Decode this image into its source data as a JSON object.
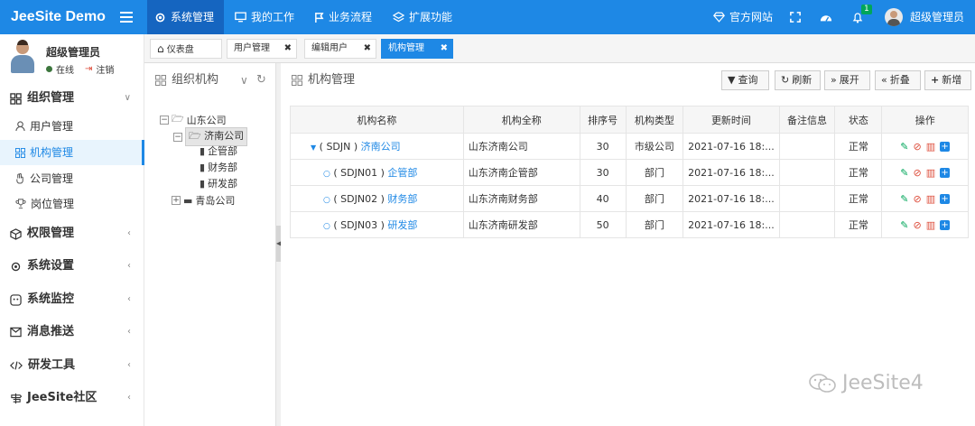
{
  "app": {
    "title": "JeeSite Demo"
  },
  "topnav": {
    "items": [
      {
        "label": "系统管理",
        "icon": "gear-icon"
      },
      {
        "label": "我的工作",
        "icon": "monitor-icon"
      },
      {
        "label": "业务流程",
        "icon": "flag-icon"
      },
      {
        "label": "扩展功能",
        "icon": "layers-icon"
      }
    ],
    "official_site": "官方网站",
    "notification_count": "1",
    "username": "超级管理员"
  },
  "user_panel": {
    "name": "超级管理员",
    "status": "在线",
    "logout": "注销"
  },
  "sidebar": {
    "groups": [
      {
        "label": "组织管理",
        "icon": "org-icon"
      },
      {
        "label": "权限管理",
        "icon": "cube-icon"
      },
      {
        "label": "系统设置",
        "icon": "gear-icon"
      },
      {
        "label": "系统监控",
        "icon": "monitor-face-icon"
      },
      {
        "label": "消息推送",
        "icon": "envelope-icon"
      },
      {
        "label": "研发工具",
        "icon": "code-icon"
      },
      {
        "label": "JeeSite社区",
        "icon": "sign-icon"
      }
    ],
    "items": [
      {
        "label": "用户管理",
        "icon": "user-icon"
      },
      {
        "label": "机构管理",
        "icon": "grid-icon"
      },
      {
        "label": "公司管理",
        "icon": "hand-icon"
      },
      {
        "label": "岗位管理",
        "icon": "trophy-icon"
      }
    ]
  },
  "tabs": [
    {
      "label": "仪表盘"
    },
    {
      "label": "用户管理"
    },
    {
      "label": "编辑用户"
    },
    {
      "label": "机构管理"
    }
  ],
  "tree": {
    "title": "组织机构",
    "nodes": [
      "山东公司",
      "济南公司",
      "企管部",
      "财务部",
      "研发部",
      "青岛公司"
    ]
  },
  "main": {
    "title": "机构管理",
    "buttons": {
      "query": "查询",
      "refresh": "刷新",
      "expand": "展开",
      "collapse": "折叠",
      "add": "新增"
    },
    "columns": [
      "机构名称",
      "机构全称",
      "排序号",
      "机构类型",
      "更新时间",
      "备注信息",
      "状态",
      "操作"
    ],
    "rows": [
      {
        "code": "( SDJN )",
        "name": "济南公司",
        "full_name": "山东济南公司",
        "sort": "30",
        "type": "市级公司",
        "updated": "2021-07-16 18:...",
        "remarks": "",
        "status": "正常"
      },
      {
        "code": "( SDJN01 )",
        "name": "企管部",
        "full_name": "山东济南企管部",
        "sort": "30",
        "type": "部门",
        "updated": "2021-07-16 18:...",
        "remarks": "",
        "status": "正常"
      },
      {
        "code": "( SDJN02 )",
        "name": "财务部",
        "full_name": "山东济南财务部",
        "sort": "40",
        "type": "部门",
        "updated": "2021-07-16 18:...",
        "remarks": "",
        "status": "正常"
      },
      {
        "code": "( SDJN03 )",
        "name": "研发部",
        "full_name": "山东济南研发部",
        "sort": "50",
        "type": "部门",
        "updated": "2021-07-16 18:...",
        "remarks": "",
        "status": "正常"
      }
    ]
  },
  "watermark": "JeeSite4"
}
